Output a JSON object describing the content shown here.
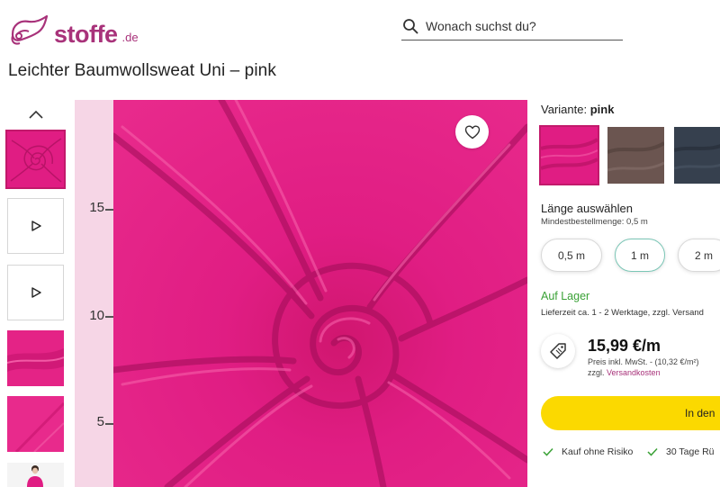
{
  "header": {
    "logo_text": "stoffe",
    "logo_tld": ".de",
    "search_placeholder": "Wonach suchst du?",
    "icons": {
      "logo": "logo-mark-icon",
      "search": "search-icon"
    }
  },
  "product": {
    "title": "Leichter Baumwollsweat Uni – pink"
  },
  "gallery": {
    "thumbnails": [
      {
        "type": "image",
        "name": "fabric-swirl"
      },
      {
        "type": "video",
        "icon": "play-icon"
      },
      {
        "type": "video",
        "icon": "play-icon"
      },
      {
        "type": "image",
        "name": "fabric-fold"
      },
      {
        "type": "image",
        "name": "fabric-flat"
      },
      {
        "type": "image",
        "name": "model"
      }
    ],
    "ruler": [
      "15",
      "10",
      "5"
    ],
    "favorite_icon": "heart-icon"
  },
  "variant": {
    "label": "Variante:",
    "value": "pink",
    "swatches": [
      {
        "name": "pink",
        "color": "#e01d83"
      },
      {
        "name": "brown",
        "color": "#6b5550"
      },
      {
        "name": "navy",
        "color": "#36404e"
      }
    ]
  },
  "length": {
    "label": "Länge auswählen",
    "min_order": "Mindestbestellmenge: 0,5 m",
    "options": [
      "0,5 m",
      "1 m",
      "2 m"
    ],
    "selected": "1 m"
  },
  "stock": {
    "status": "Auf Lager",
    "delivery": "Lieferzeit ca. 1 - 2 Werktage, zzgl. Versand"
  },
  "price": {
    "amount": "15,99 €/m",
    "note": "Preis inkl. MwSt. - (10,32 €/m²)",
    "shipping_prefix": "zzgl.",
    "shipping_link": "Versandkosten",
    "icon": "price-tag-icon"
  },
  "cart": {
    "label": "In den"
  },
  "benefits": [
    "Kauf ohne Risiko",
    "30 Tage Rü"
  ],
  "colors": {
    "brand": "#a8327a",
    "accent_pink": "#c2196b",
    "fabric_pink": "#e01d83",
    "stock_green": "#3aa136",
    "cart_yellow": "#fbd900",
    "selected_outline": "#7bc6b6"
  }
}
